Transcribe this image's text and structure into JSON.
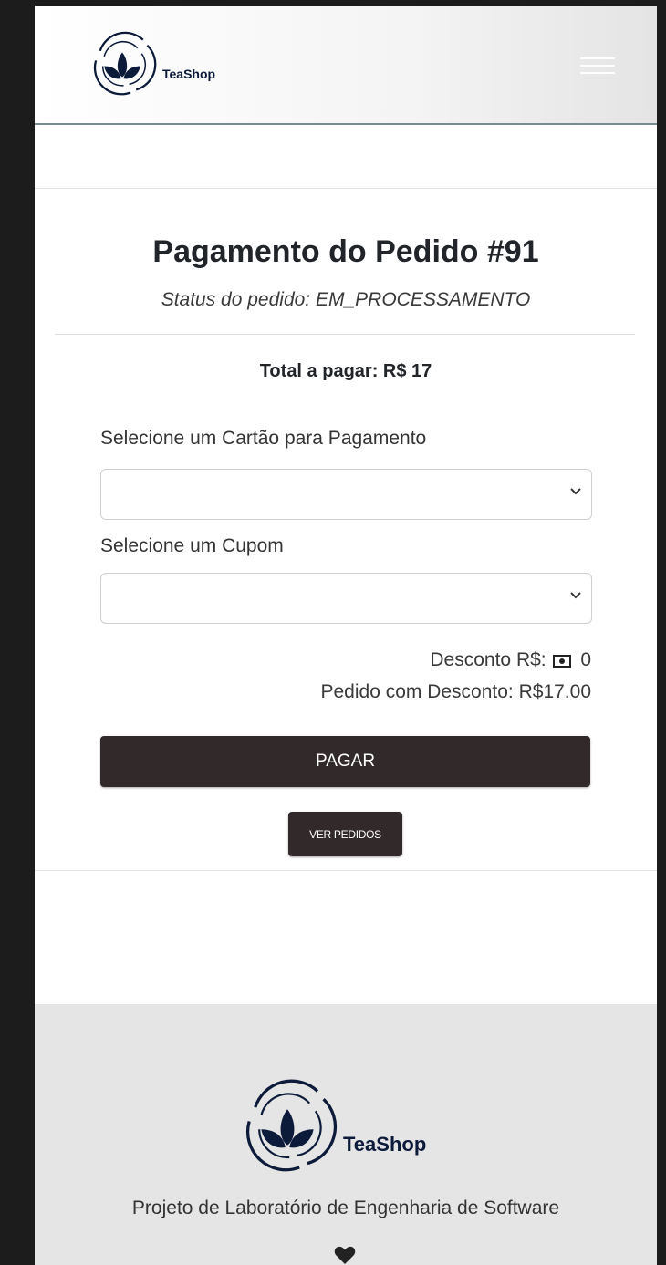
{
  "header": {
    "brand": "TeaShop",
    "menu_icon": "hamburger-icon"
  },
  "payment": {
    "title": "Pagamento do Pedido #91",
    "status": "Status do pedido: EM_PROCESSAMENTO",
    "total": "Total a pagar: R$ 17",
    "card_label": "Selecione um Cartão para Pagamento",
    "card_value": "",
    "coupon_label": "Selecione um Cupom",
    "coupon_value": "",
    "discount_label": "Desconto R$:",
    "discount_value": "0",
    "discounted_total": "Pedido com Desconto: R$17.00",
    "pay_button": "PAGAR",
    "orders_button": "VER PEDIDOS"
  },
  "footer": {
    "brand": "TeaShop",
    "description": "Projeto de Laboratório de Engenharia de Software",
    "heart_icon": "heart-icon"
  },
  "colors": {
    "brand_navy": "#0d1b3a",
    "button_dark": "#322a2a",
    "footer_bg": "#e5e5e5"
  }
}
